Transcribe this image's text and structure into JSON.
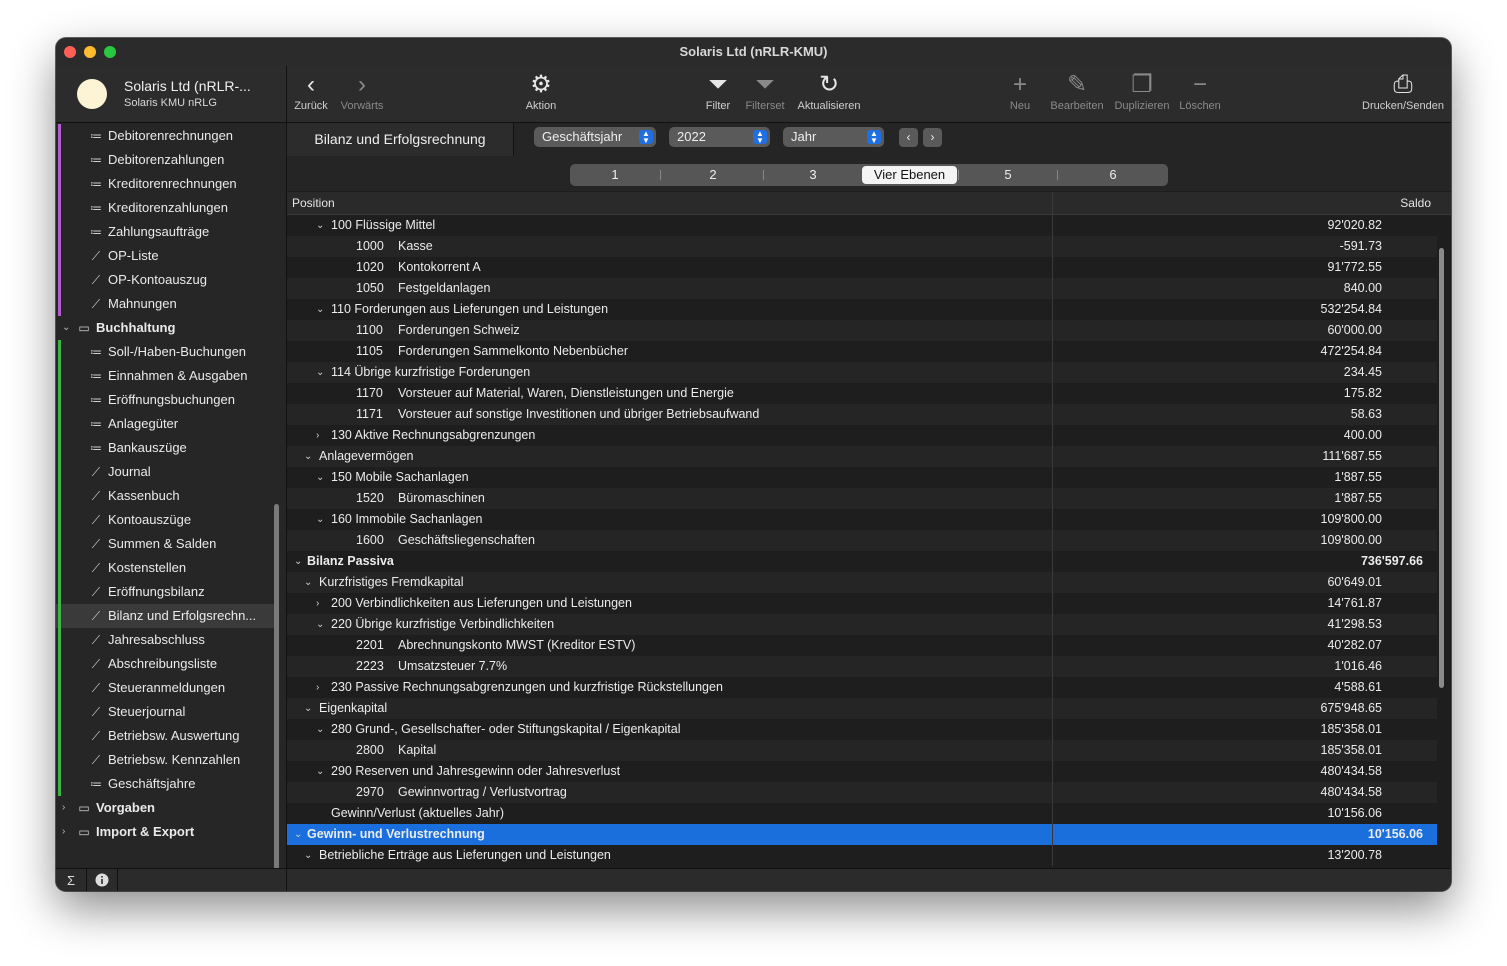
{
  "window": {
    "title": "Solaris Ltd  (nRLR-KMU)"
  },
  "account": {
    "name": "Solaris Ltd  (nRLR-...",
    "subtitle": "Solaris KMU nRLG"
  },
  "sidebar": {
    "items": [
      {
        "label": "Debitorenrechnungen",
        "icon": "list-icon",
        "group": false,
        "accent": "#b15fd0"
      },
      {
        "label": "Debitorenzahlungen",
        "icon": "list-icon",
        "group": false,
        "accent": "#b15fd0"
      },
      {
        "label": "Kreditorenrechnungen",
        "icon": "list-icon",
        "group": false,
        "accent": "#b15fd0"
      },
      {
        "label": "Kreditorenzahlungen",
        "icon": "list-icon",
        "group": false,
        "accent": "#b15fd0"
      },
      {
        "label": "Zahlungsaufträge",
        "icon": "list-icon",
        "group": false,
        "accent": "#b15fd0"
      },
      {
        "label": "OP-Liste",
        "icon": "chart-icon",
        "group": false,
        "accent": "#b15fd0"
      },
      {
        "label": "OP-Kontoauszug",
        "icon": "chart-icon",
        "group": false,
        "accent": "#b15fd0"
      },
      {
        "label": "Mahnungen",
        "icon": "chart-icon",
        "group": false,
        "accent": "#b15fd0"
      },
      {
        "label": "Buchhaltung",
        "icon": "folder-icon",
        "group": true,
        "accent": ""
      },
      {
        "label": "Soll-/Haben-Buchungen",
        "icon": "list-icon",
        "group": false,
        "accent": "#3fb24a"
      },
      {
        "label": "Einnahmen & Ausgaben",
        "icon": "list-icon",
        "group": false,
        "accent": "#3fb24a"
      },
      {
        "label": "Eröffnungsbuchungen",
        "icon": "list-icon",
        "group": false,
        "accent": "#3fb24a"
      },
      {
        "label": "Anlagegüter",
        "icon": "list-icon",
        "group": false,
        "accent": "#3fb24a"
      },
      {
        "label": "Bankauszüge",
        "icon": "list-icon",
        "group": false,
        "accent": "#3fb24a"
      },
      {
        "label": "Journal",
        "icon": "chart-icon",
        "group": false,
        "accent": "#3fb24a"
      },
      {
        "label": "Kassenbuch",
        "icon": "chart-icon",
        "group": false,
        "accent": "#3fb24a"
      },
      {
        "label": "Kontoauszüge",
        "icon": "chart-icon",
        "group": false,
        "accent": "#3fb24a"
      },
      {
        "label": "Summen & Salden",
        "icon": "chart-icon",
        "group": false,
        "accent": "#3fb24a"
      },
      {
        "label": "Kostenstellen",
        "icon": "chart-icon",
        "group": false,
        "accent": "#3fb24a"
      },
      {
        "label": "Eröffnungsbilanz",
        "icon": "chart-icon",
        "group": false,
        "accent": "#3fb24a"
      },
      {
        "label": "Bilanz und Erfolgsrechn...",
        "icon": "chart-icon",
        "group": false,
        "accent": "#3fb24a",
        "selected": true
      },
      {
        "label": "Jahresabschluss",
        "icon": "chart-icon",
        "group": false,
        "accent": "#3fb24a"
      },
      {
        "label": "Abschreibungsliste",
        "icon": "chart-icon",
        "group": false,
        "accent": "#3fb24a"
      },
      {
        "label": "Steueranmeldungen",
        "icon": "chart-icon",
        "group": false,
        "accent": "#3fb24a"
      },
      {
        "label": "Steuerjournal",
        "icon": "chart-icon",
        "group": false,
        "accent": "#3fb24a"
      },
      {
        "label": "Betriebsw. Auswertung",
        "icon": "chart-icon",
        "group": false,
        "accent": "#3fb24a"
      },
      {
        "label": "Betriebsw. Kennzahlen",
        "icon": "chart-icon",
        "group": false,
        "accent": "#3fb24a"
      },
      {
        "label": "Geschäftsjahre",
        "icon": "list-icon",
        "group": false,
        "accent": "#3fb24a"
      },
      {
        "label": "Vorgaben",
        "icon": "folder-icon",
        "group": true,
        "accent": "",
        "collapsed": true
      },
      {
        "label": "Import & Export",
        "icon": "folder-icon",
        "group": true,
        "accent": "",
        "collapsed": true
      }
    ],
    "bottom": {
      "sum_label": "Σ",
      "info_label": "i"
    }
  },
  "toolbar": {
    "back": "Zurück",
    "forward": "Vorwärts",
    "action": "Aktion",
    "filter": "Filter",
    "filterset": "Filterset",
    "refresh": "Aktualisieren",
    "new": "Neu",
    "edit": "Bearbeiten",
    "duplicate": "Duplizieren",
    "delete": "Löschen",
    "print": "Drucken/Senden"
  },
  "header": {
    "title": "Bilanz und Erfolgsrechnung",
    "period_type": "Geschäftsjahr",
    "year": "2022",
    "granularity": "Jahr",
    "levels": [
      "1",
      "2",
      "3",
      "Vier Ebenen",
      "5",
      "6"
    ],
    "active_level": "Vier Ebenen"
  },
  "table": {
    "columns": {
      "position": "Position",
      "saldo": "Saldo"
    },
    "rows": [
      {
        "level": 2,
        "chev": "down",
        "code": "",
        "name": "100 Flüssige Mittel",
        "saldo": "92'020.82"
      },
      {
        "level": 3,
        "chev": "",
        "code": "1000",
        "name": "Kasse",
        "saldo": "-591.73"
      },
      {
        "level": 3,
        "chev": "",
        "code": "1020",
        "name": "Kontokorrent A",
        "saldo": "91'772.55"
      },
      {
        "level": 3,
        "chev": "",
        "code": "1050",
        "name": "Festgeldanlagen",
        "saldo": "840.00"
      },
      {
        "level": 2,
        "chev": "down",
        "code": "",
        "name": "110 Forderungen aus Lieferungen und Leistungen",
        "saldo": "532'254.84"
      },
      {
        "level": 3,
        "chev": "",
        "code": "1100",
        "name": "Forderungen Schweiz",
        "saldo": "60'000.00"
      },
      {
        "level": 3,
        "chev": "",
        "code": "1105",
        "name": "Forderungen Sammelkonto Nebenbücher",
        "saldo": "472'254.84"
      },
      {
        "level": 2,
        "chev": "down",
        "code": "",
        "name": "114 Übrige kurzfristige Forderungen",
        "saldo": "234.45"
      },
      {
        "level": 3,
        "chev": "",
        "code": "1170",
        "name": "Vorsteuer auf Material, Waren, Dienstleistungen und Energie",
        "saldo": "175.82"
      },
      {
        "level": 3,
        "chev": "",
        "code": "1171",
        "name": "Vorsteuer auf sonstige Investitionen und übriger Betriebsaufwand",
        "saldo": "58.63"
      },
      {
        "level": 2,
        "chev": "right",
        "code": "",
        "name": "130 Aktive Rechnungsabgrenzungen",
        "saldo": "400.00"
      },
      {
        "level": 1,
        "chev": "down",
        "code": "",
        "name": "Anlagevermögen",
        "saldo": "111'687.55"
      },
      {
        "level": 2,
        "chev": "down",
        "code": "",
        "name": "150 Mobile Sachanlagen",
        "saldo": "1'887.55"
      },
      {
        "level": 3,
        "chev": "",
        "code": "1520",
        "name": "Büromaschinen",
        "saldo": "1'887.55"
      },
      {
        "level": 2,
        "chev": "down",
        "code": "",
        "name": "160 Immobile Sachanlagen",
        "saldo": "109'800.00"
      },
      {
        "level": 3,
        "chev": "",
        "code": "1600",
        "name": "Geschäftsliegenschaften",
        "saldo": "109'800.00"
      },
      {
        "level": 0,
        "chev": "down",
        "code": "",
        "name": "Bilanz Passiva",
        "saldo": "736'597.66",
        "bold": true
      },
      {
        "level": 1,
        "chev": "down",
        "code": "",
        "name": "Kurzfristiges Fremdkapital",
        "saldo": "60'649.01"
      },
      {
        "level": 2,
        "chev": "right",
        "code": "",
        "name": "200 Verbindlichkeiten aus Lieferungen und Leistungen",
        "saldo": "14'761.87"
      },
      {
        "level": 2,
        "chev": "down",
        "code": "",
        "name": "220 Übrige kurzfristige Verbindlichkeiten",
        "saldo": "41'298.53"
      },
      {
        "level": 3,
        "chev": "",
        "code": "2201",
        "name": "Abrechnungskonto MWST (Kreditor ESTV)",
        "saldo": "40'282.07"
      },
      {
        "level": 3,
        "chev": "",
        "code": "2223",
        "name": "Umsatzsteuer 7.7%",
        "saldo": "1'016.46"
      },
      {
        "level": 2,
        "chev": "right",
        "code": "",
        "name": "230 Passive Rechnungsabgrenzungen und kurzfristige Rückstellungen",
        "saldo": "4'588.61"
      },
      {
        "level": 1,
        "chev": "down",
        "code": "",
        "name": "Eigenkapital",
        "saldo": "675'948.65"
      },
      {
        "level": 2,
        "chev": "down",
        "code": "",
        "name": "280 Grund-, Gesellschafter- oder Stiftungskapital / Eigenkapital",
        "saldo": "185'358.01"
      },
      {
        "level": 3,
        "chev": "",
        "code": "2800",
        "name": "Kapital",
        "saldo": "185'358.01"
      },
      {
        "level": 2,
        "chev": "down",
        "code": "",
        "name": "290 Reserven und Jahresgewinn oder Jahresverlust",
        "saldo": "480'434.58"
      },
      {
        "level": 3,
        "chev": "",
        "code": "2970",
        "name": "Gewinnvortrag / Verlustvortrag",
        "saldo": "480'434.58"
      },
      {
        "level": 2,
        "chev": "",
        "code": "",
        "name": "Gewinn/Verlust (aktuelles Jahr)",
        "saldo": "10'156.06"
      },
      {
        "level": 0,
        "chev": "down",
        "code": "",
        "name": "Gewinn- und Verlustrechnung",
        "saldo": "10'156.06",
        "bold": true,
        "selected": true
      },
      {
        "level": 1,
        "chev": "down",
        "code": "",
        "name": "Betriebliche Erträge aus Lieferungen und Leistungen",
        "saldo": "13'200.78"
      }
    ]
  }
}
